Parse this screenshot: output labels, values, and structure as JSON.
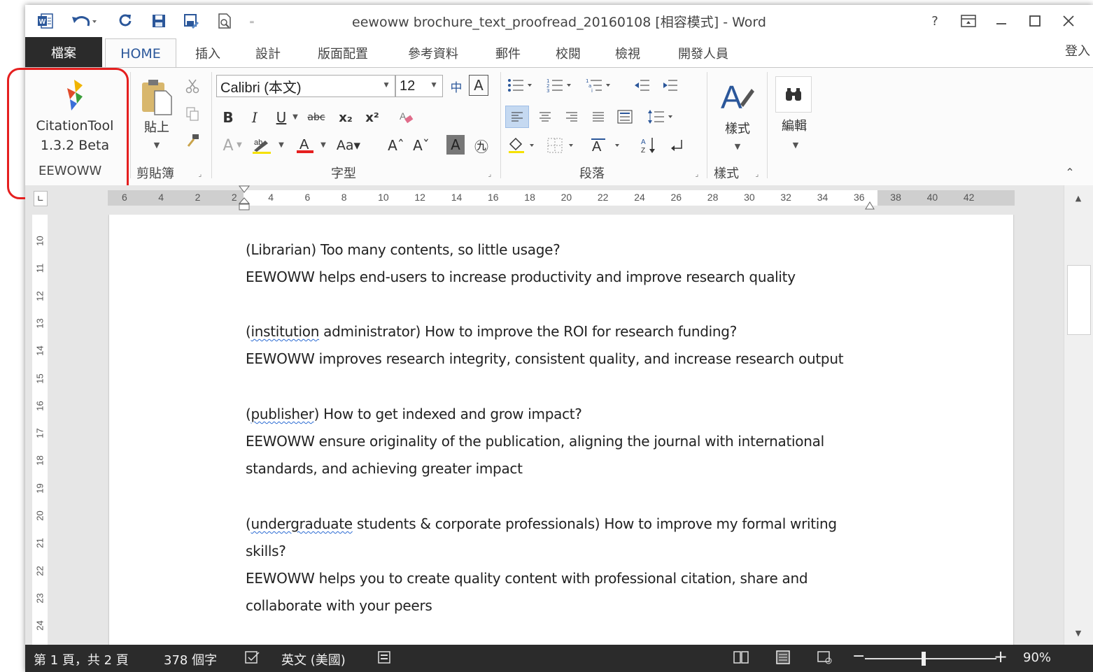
{
  "app": {
    "title": "eewoww brochure_text_proofread_20160108 [相容模式] - Word",
    "help": "?",
    "signin": "登入"
  },
  "tabs": {
    "file": "檔案",
    "home": "HOME",
    "items": [
      "插入",
      "設計",
      "版面配置",
      "參考資料",
      "郵件",
      "校閱",
      "檢視",
      "開發人員"
    ]
  },
  "ribbon": {
    "citation": {
      "label1": "CitationTool",
      "label2": "1.3.2 Beta",
      "group": "EEWOWW"
    },
    "clipboard": {
      "paste": "貼上",
      "group": "剪貼簿"
    },
    "font": {
      "name": "Calibri (本文)",
      "size": "12",
      "group": "字型"
    },
    "paragraph": {
      "group": "段落"
    },
    "styles": {
      "label": "樣式",
      "group": "樣式"
    },
    "editing": {
      "label": "編輯"
    }
  },
  "ruler": {
    "labels": [
      "6",
      "4",
      "2",
      "2",
      "4",
      "6",
      "8",
      "10",
      "12",
      "14",
      "16",
      "18",
      "20",
      "22",
      "24",
      "26",
      "28",
      "30",
      "32",
      "34",
      "36",
      "38",
      "40",
      "42"
    ],
    "vlabels": [
      "10",
      "11",
      "12",
      "13",
      "14",
      "15",
      "16",
      "17",
      "18",
      "19",
      "20",
      "21",
      "22",
      "23",
      "24"
    ]
  },
  "document": {
    "lines": [
      {
        "pre": "(Librarian) Too many contents, so little usage?",
        "err": "",
        "post": ""
      },
      {
        "pre": "EEWOWW helps end-users to increase productivity and improve research quality",
        "err": "",
        "post": ""
      },
      {
        "pre": "(",
        "err": "institution",
        "post": " administrator) How to improve the ROI for research funding?"
      },
      {
        "pre": "EEWOWW improves research integrity, consistent quality, and increase research output",
        "err": "",
        "post": ""
      },
      {
        "pre": "(",
        "err": "publisher",
        "post": ") How to get indexed and grow impact?"
      },
      {
        "pre": "EEWOWW ensure originality of the publication, aligning the journal with international",
        "err": "",
        "post": ""
      },
      {
        "pre": "standards, and achieving greater impact",
        "err": "",
        "post": ""
      },
      {
        "pre": "(",
        "err": "undergraduate",
        "post": " students & corporate professionals) How to improve my formal writing"
      },
      {
        "pre": "skills?",
        "err": "",
        "post": ""
      },
      {
        "pre": "EEWOWW helps you to create quality content with professional citation, share and",
        "err": "",
        "post": ""
      },
      {
        "pre": "collaborate with your peers",
        "err": "",
        "post": ""
      }
    ]
  },
  "status": {
    "page": "第 1 頁，共 2 頁",
    "words": "378 個字",
    "language": "英文 (美國)",
    "zoom": "90%",
    "zoom_level_percent": 90
  },
  "colors": {
    "accent": "#2b579a",
    "highlight_box": "#e51f1f",
    "statusbar": "#2b2b2b",
    "spell_error": "#2b6bd3"
  }
}
